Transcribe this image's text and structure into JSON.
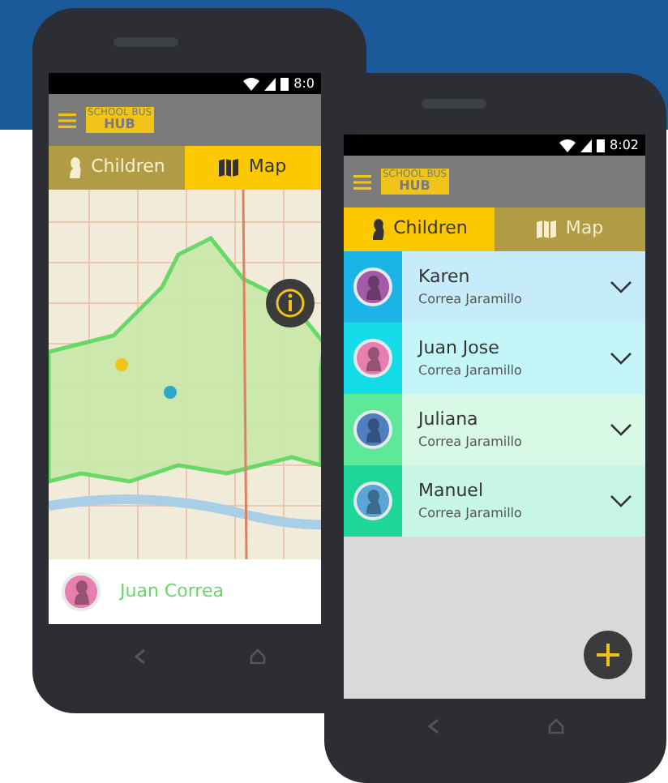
{
  "back_phone": {
    "status_time": "8:0",
    "logo": {
      "line_1": "SCHOOL BUS",
      "line_2": "HUB"
    },
    "tabs": [
      {
        "label": "Children",
        "kind": "children",
        "selected": false
      },
      {
        "label": "Map",
        "kind": "map",
        "selected": true
      }
    ],
    "selected_child": {
      "name": "Juan Correa",
      "color": "#e67fb0"
    }
  },
  "front_phone": {
    "status_time": "8:02",
    "logo": {
      "line_1": "SCHOOL BUS",
      "line_2": "HUB"
    },
    "tabs": [
      {
        "label": "Children",
        "kind": "children",
        "selected": true
      },
      {
        "label": "Map",
        "kind": "map",
        "selected": false
      }
    ],
    "children": [
      {
        "name": "Karen",
        "surname": "Correa Jaramillo",
        "color": "#1ab4e6",
        "avatar": {
          "color": "#a35aa8"
        }
      },
      {
        "name": "Juan Jose",
        "surname": "Correa Jaramillo",
        "color": "#14dce8",
        "avatar": {
          "color": "#e67fb0"
        }
      },
      {
        "name": "Juliana",
        "surname": "Correa Jaramillo",
        "color": "#5ee89a",
        "avatar": {
          "color": "#4f7fc0"
        }
      },
      {
        "name": "Manuel",
        "surname": "Correa Jaramillo",
        "color": "#1fd69a",
        "avatar": {
          "color": "#5aa6d6"
        }
      }
    ]
  }
}
